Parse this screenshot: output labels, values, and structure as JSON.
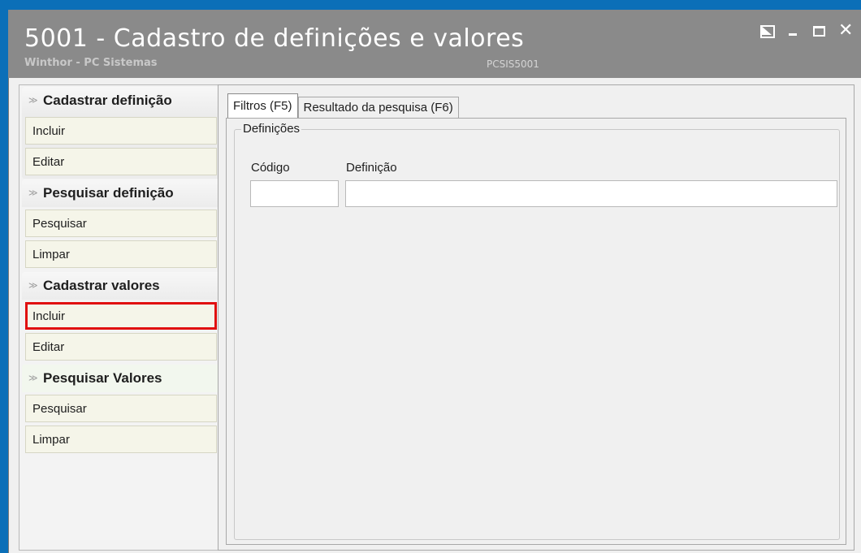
{
  "window": {
    "title": "5001 - Cadastro de definições e valores",
    "subtitle": "Winthor - PC Sistemas",
    "routine_code": "PCSIS5001"
  },
  "sidebar": {
    "groups": [
      {
        "title": "Cadastrar definição",
        "items": [
          {
            "label": "Incluir"
          },
          {
            "label": "Editar"
          }
        ]
      },
      {
        "title": "Pesquisar definição",
        "items": [
          {
            "label": "Pesquisar"
          },
          {
            "label": "Limpar"
          }
        ]
      },
      {
        "title": "Cadastrar valores",
        "items": [
          {
            "label": "Incluir",
            "highlighted": true
          },
          {
            "label": "Editar"
          }
        ]
      },
      {
        "title": "Pesquisar Valores",
        "items": [
          {
            "label": "Pesquisar"
          },
          {
            "label": "Limpar"
          }
        ]
      }
    ]
  },
  "tabs": [
    {
      "label": "Filtros (F5)",
      "active": true
    },
    {
      "label": "Resultado da pesquisa (F6)",
      "active": false
    }
  ],
  "filters": {
    "group_label": "Definições",
    "codigo_label": "Código",
    "codigo_value": "",
    "definicao_label": "Definição",
    "definicao_value": ""
  },
  "colors": {
    "frame": "#0b6fb8",
    "titlebar": "#8a8a8a",
    "highlight": "#e01010"
  }
}
